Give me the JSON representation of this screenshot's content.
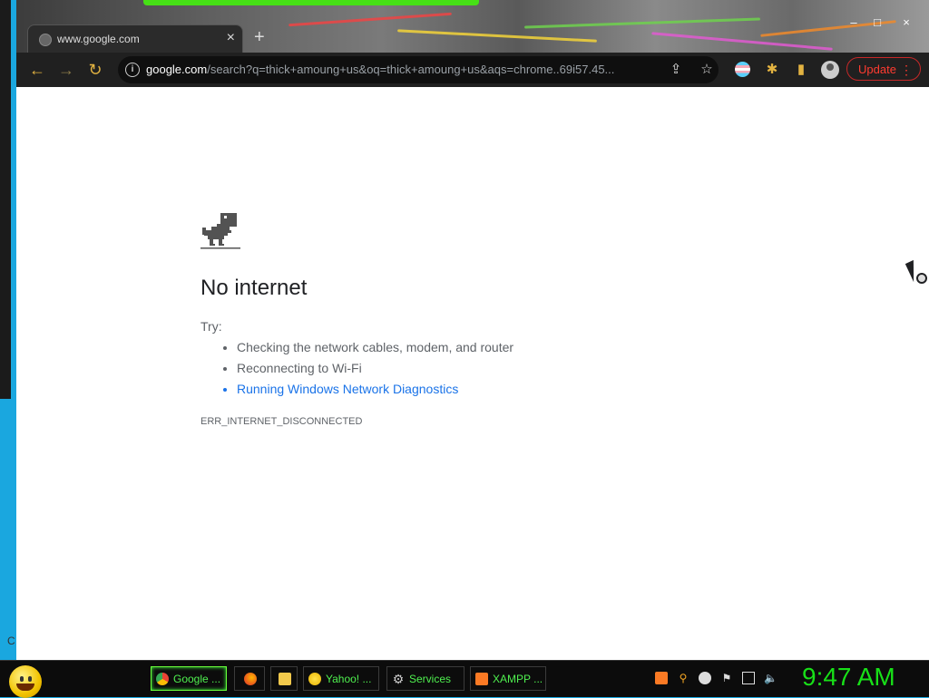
{
  "browser": {
    "tab": {
      "title": "www.google.com",
      "close_label": "×"
    },
    "new_tab_label": "+",
    "window_controls": {
      "minimize": "–",
      "maximize": "□",
      "close": "×"
    },
    "toolbar": {
      "back_icon": "←",
      "forward_icon": "→",
      "reload_icon": "↻",
      "url_host": "google.com",
      "url_rest": "/search?q=thick+amoung+us&oq=thick+amoung+us&aqs=chrome..69i57.45...",
      "share_icon": "⇪",
      "bookmark_icon": "☆",
      "extensions_icon": "✱",
      "sidepanel_icon": "▮",
      "update_label": "Update",
      "menu_icon": "⋮"
    }
  },
  "page": {
    "heading": "No internet",
    "try_label": "Try:",
    "suggestions": [
      "Checking the network cables, modem, and router",
      "Reconnecting to Wi-Fi",
      "Running Windows Network Diagnostics"
    ],
    "error_code": "ERR_INTERNET_DISCONNECTED"
  },
  "desktop": {
    "edge_text": "C"
  },
  "taskbar": {
    "tasks": [
      {
        "label": "Google ...",
        "icon": "chrome-icon"
      },
      {
        "label": "",
        "icon": "firefox-icon"
      },
      {
        "label": "",
        "icon": "folder-icon"
      },
      {
        "label": "Yahoo! ...",
        "icon": "yahoo-icon"
      },
      {
        "label": "Services",
        "icon": "gear-icon"
      },
      {
        "label": "XAMPP ...",
        "icon": "xampp-icon"
      }
    ],
    "clock": "9:47 AM"
  },
  "colors": {
    "accent_yellow": "#e3b341",
    "update_red": "#ff3b30",
    "link_blue": "#1a73e8",
    "taskbar_green": "#4ff04f",
    "clock_green": "#18e018"
  }
}
